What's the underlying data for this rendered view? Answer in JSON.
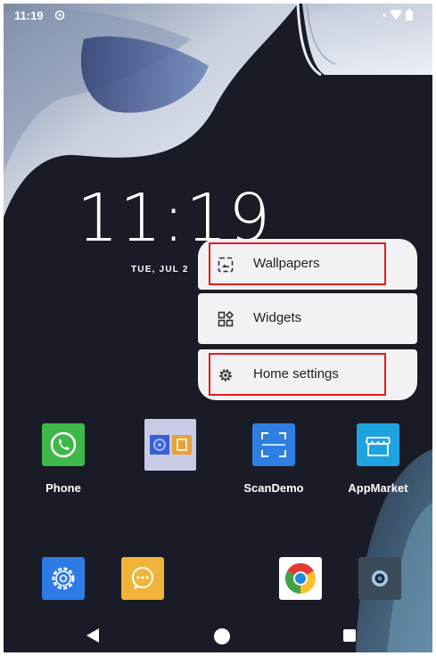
{
  "status_bar": {
    "time": "11:19"
  },
  "clock": {
    "time": "11:19",
    "date": "TUE, JUL 2"
  },
  "menu": {
    "items": [
      {
        "label": "Wallpapers",
        "icon": "wallpaper-icon"
      },
      {
        "label": "Widgets",
        "icon": "widgets-icon"
      },
      {
        "label": "Home settings",
        "icon": "gear-icon"
      }
    ]
  },
  "apps_row1": [
    {
      "label": "Phone",
      "icon": "phone-icon",
      "color": "#3fb84a"
    },
    {
      "label": "",
      "icon": "folder-icon",
      "color": "#c9cbe6"
    },
    {
      "label": "ScanDemo",
      "icon": "scan-icon",
      "color": "#2f7fe3"
    },
    {
      "label": "AppMarket",
      "icon": "store-icon",
      "color": "#1ea3e0"
    }
  ],
  "dock": [
    {
      "icon": "settings-app-icon",
      "color": "#2e7be6"
    },
    {
      "icon": "messaging-icon",
      "color": "#f0b43a"
    },
    {
      "icon": "chrome-icon",
      "color": "#ffffff"
    },
    {
      "icon": "camera-icon",
      "color": "#3c4b5a"
    }
  ],
  "nav": {
    "back": "back-icon",
    "home": "home-icon",
    "recents": "recents-icon"
  }
}
